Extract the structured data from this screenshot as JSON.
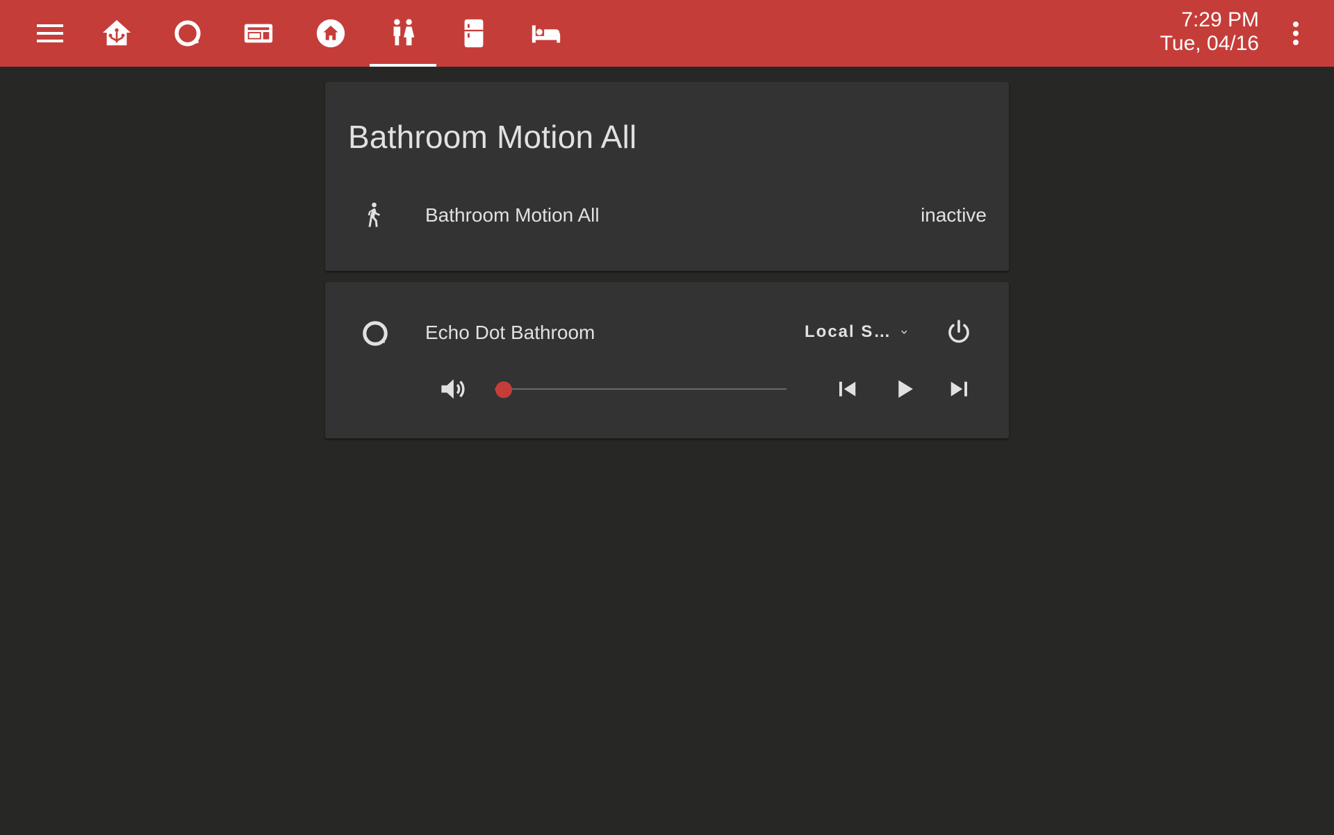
{
  "colors": {
    "accent": "#c53d39",
    "background": "#272825",
    "card": "#333333",
    "text": "#e1e1e1",
    "topbar_text": "#ffffff"
  },
  "topbar": {
    "menu_icon": "hamburger-menu-icon",
    "tabs": [
      {
        "icon": "home-assistant-icon",
        "active": false
      },
      {
        "icon": "amazon-alexa-icon",
        "active": false
      },
      {
        "icon": "media-player-icon",
        "active": false
      },
      {
        "icon": "home-circle-icon",
        "active": false
      },
      {
        "icon": "human-male-female-icon",
        "active": true
      },
      {
        "icon": "fridge-icon",
        "active": false
      },
      {
        "icon": "bed-icon",
        "active": false
      }
    ],
    "time": "7:29 PM",
    "date": "Tue, 04/16",
    "more_icon": "dots-vertical-icon"
  },
  "entities_card": {
    "title": "Bathroom Motion All",
    "rows": [
      {
        "icon": "walking-person-icon",
        "name": "Bathroom Motion All",
        "state": "inactive"
      }
    ]
  },
  "media_card": {
    "icon": "alexa-ring-icon",
    "name": "Echo Dot Bathroom",
    "source": "Local S…",
    "volume": 0.03
  }
}
